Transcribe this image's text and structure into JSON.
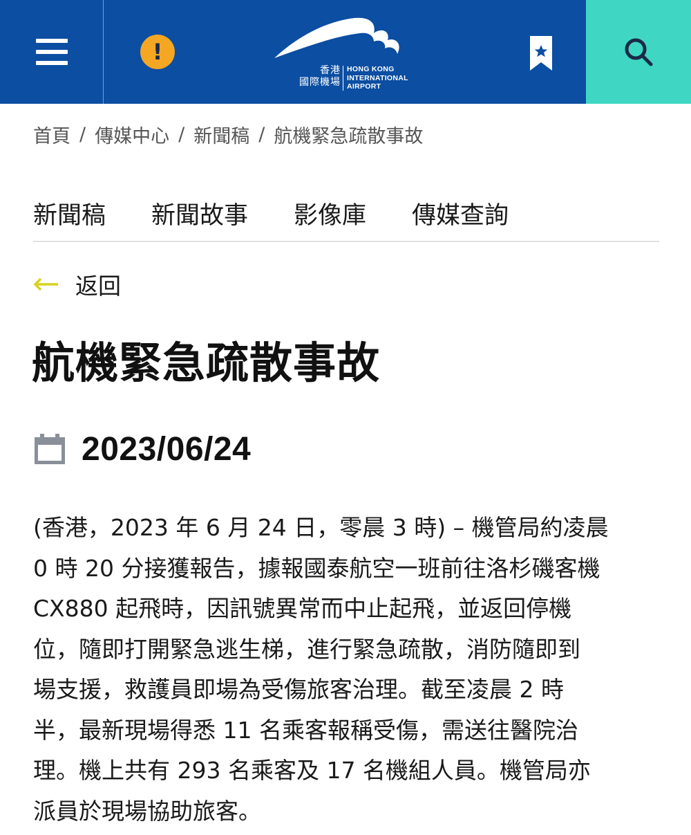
{
  "header": {
    "menu_icon": "hamburger-menu-icon",
    "alert_icon": "exclamation-alert-icon",
    "alert_symbol": "!",
    "logo": {
      "zh_line1": "香港",
      "zh_line2": "國際機場",
      "en_line1": "HONG KONG",
      "en_line2": "INTERNATIONAL",
      "en_line3": "AIRPORT"
    },
    "bookmark_icon": "bookmark-star-icon",
    "search_icon": "search-icon"
  },
  "breadcrumb": {
    "items": [
      "首頁",
      "傳媒中心",
      "新聞稿",
      "航機緊急疏散事故"
    ],
    "separator": "/"
  },
  "tabs": [
    "新聞稿",
    "新聞故事",
    "影像庫",
    "傳媒查詢"
  ],
  "back": {
    "label": "返回",
    "icon": "left-arrow-icon"
  },
  "article": {
    "title": "航機緊急疏散事故",
    "date_icon": "calendar-icon",
    "date": "2023/06/24",
    "body_lines": [
      "(香港，2023 年 6 月 24 日，零晨 3 時) – 機管局約凌晨",
      "0 時 20 分接獲報告，據報國泰航空一班前往洛杉磯客機",
      "CX880 起飛時，因訊號異常而中止起飛，並返回停機",
      "位，隨即打開緊急逃生梯，進行緊急疏散，消防隨即到",
      "場支援，救護員即場為受傷旅客治理。截至凌晨 2 時",
      "半，最新現場得悉 11 名乘客報稱受傷，需送往醫院治",
      "理。機上共有 293 名乘客及 17 名機組人員。機管局亦",
      "派員於現場協助旅客。"
    ]
  },
  "colors": {
    "header_blue": "#0b4ea2",
    "search_teal": "#3fd7c3",
    "alert_orange": "#f5a623",
    "back_arrow_yellow": "#d9d21e",
    "calendar_gray": "#8a9099"
  }
}
